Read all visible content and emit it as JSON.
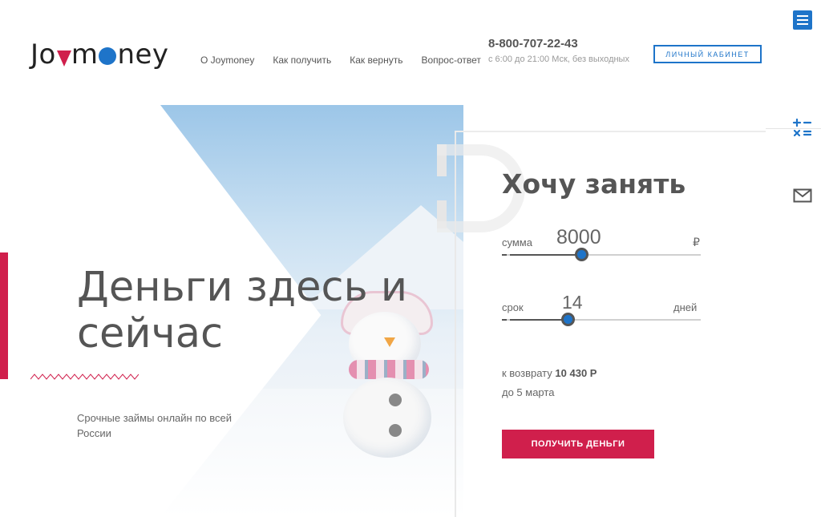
{
  "header": {
    "logo_text": "Joymoney",
    "nav": [
      {
        "label": "О Joymoney"
      },
      {
        "label": "Как получить"
      },
      {
        "label": "Как вернуть"
      },
      {
        "label": "Вопрос-ответ"
      }
    ],
    "phone": "8-800-707-22-43",
    "hours": "с 6:00 до 21:00 Мск, без выходных",
    "cabinet_label": "ЛИЧНЫЙ КАБИНЕТ"
  },
  "hero": {
    "title": "Деньги здесь и сейчас",
    "subtitle": "Срочные займы онлайн по всей России"
  },
  "calculator": {
    "title": "Хочу занять",
    "sum_label": "сумма",
    "sum_value": "8000",
    "currency": "₽",
    "sum_slider_fraction": 0.4,
    "term_label": "срок",
    "term_value": "14",
    "term_unit": "дней",
    "term_slider_fraction": 0.33,
    "repay_prefix": "к возврату",
    "repay_amount": "10 430 Р",
    "until": "до 5 марта",
    "submit_label": "ПОЛУЧИТЬ ДЕНЬГИ"
  },
  "colors": {
    "accent": "#1e74c9",
    "brand_red": "#d01f4c"
  },
  "icons": {
    "menu": "menu-icon",
    "calculator": "calculator-icon",
    "mail": "mail-icon"
  }
}
